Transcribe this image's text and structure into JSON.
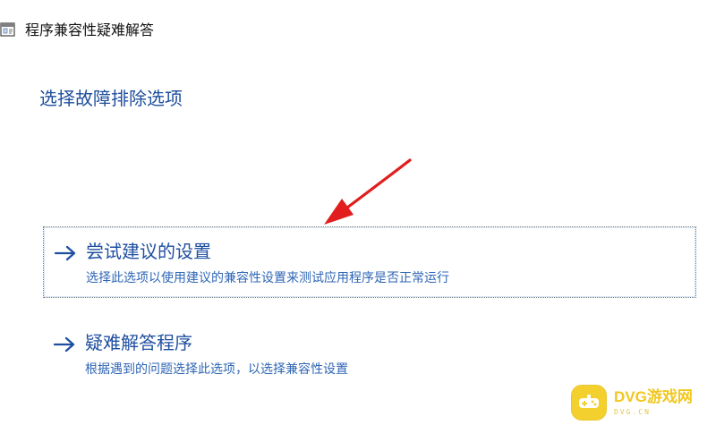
{
  "window": {
    "title": "程序兼容性疑难解答",
    "icon": "troubleshooter-window-icon"
  },
  "page": {
    "heading": "选择故障排除选项"
  },
  "options": [
    {
      "title": "尝试建议的设置",
      "description": "选择此选项以使用建议的兼容性设置来测试应用程序是否正常运行",
      "icon": "arrow-right-icon",
      "selected": true
    },
    {
      "title": "疑难解答程序",
      "description": "根据遇到的问题选择此选项，以选择兼容性设置",
      "icon": "arrow-right-icon",
      "selected": false
    }
  ],
  "annotation": {
    "type": "red-arrow",
    "color": "#e11d1d"
  },
  "watermark": {
    "text": "DVG游戏网",
    "subtext": "DVG.CN",
    "color": "#f2c71c",
    "icon": "gamepad-icon"
  },
  "colors": {
    "link": "#1f4fa0",
    "heading": "#1e4f9c",
    "description": "#2f66b5",
    "focus_border": "#7a7a7a",
    "background": "#ffffff"
  }
}
